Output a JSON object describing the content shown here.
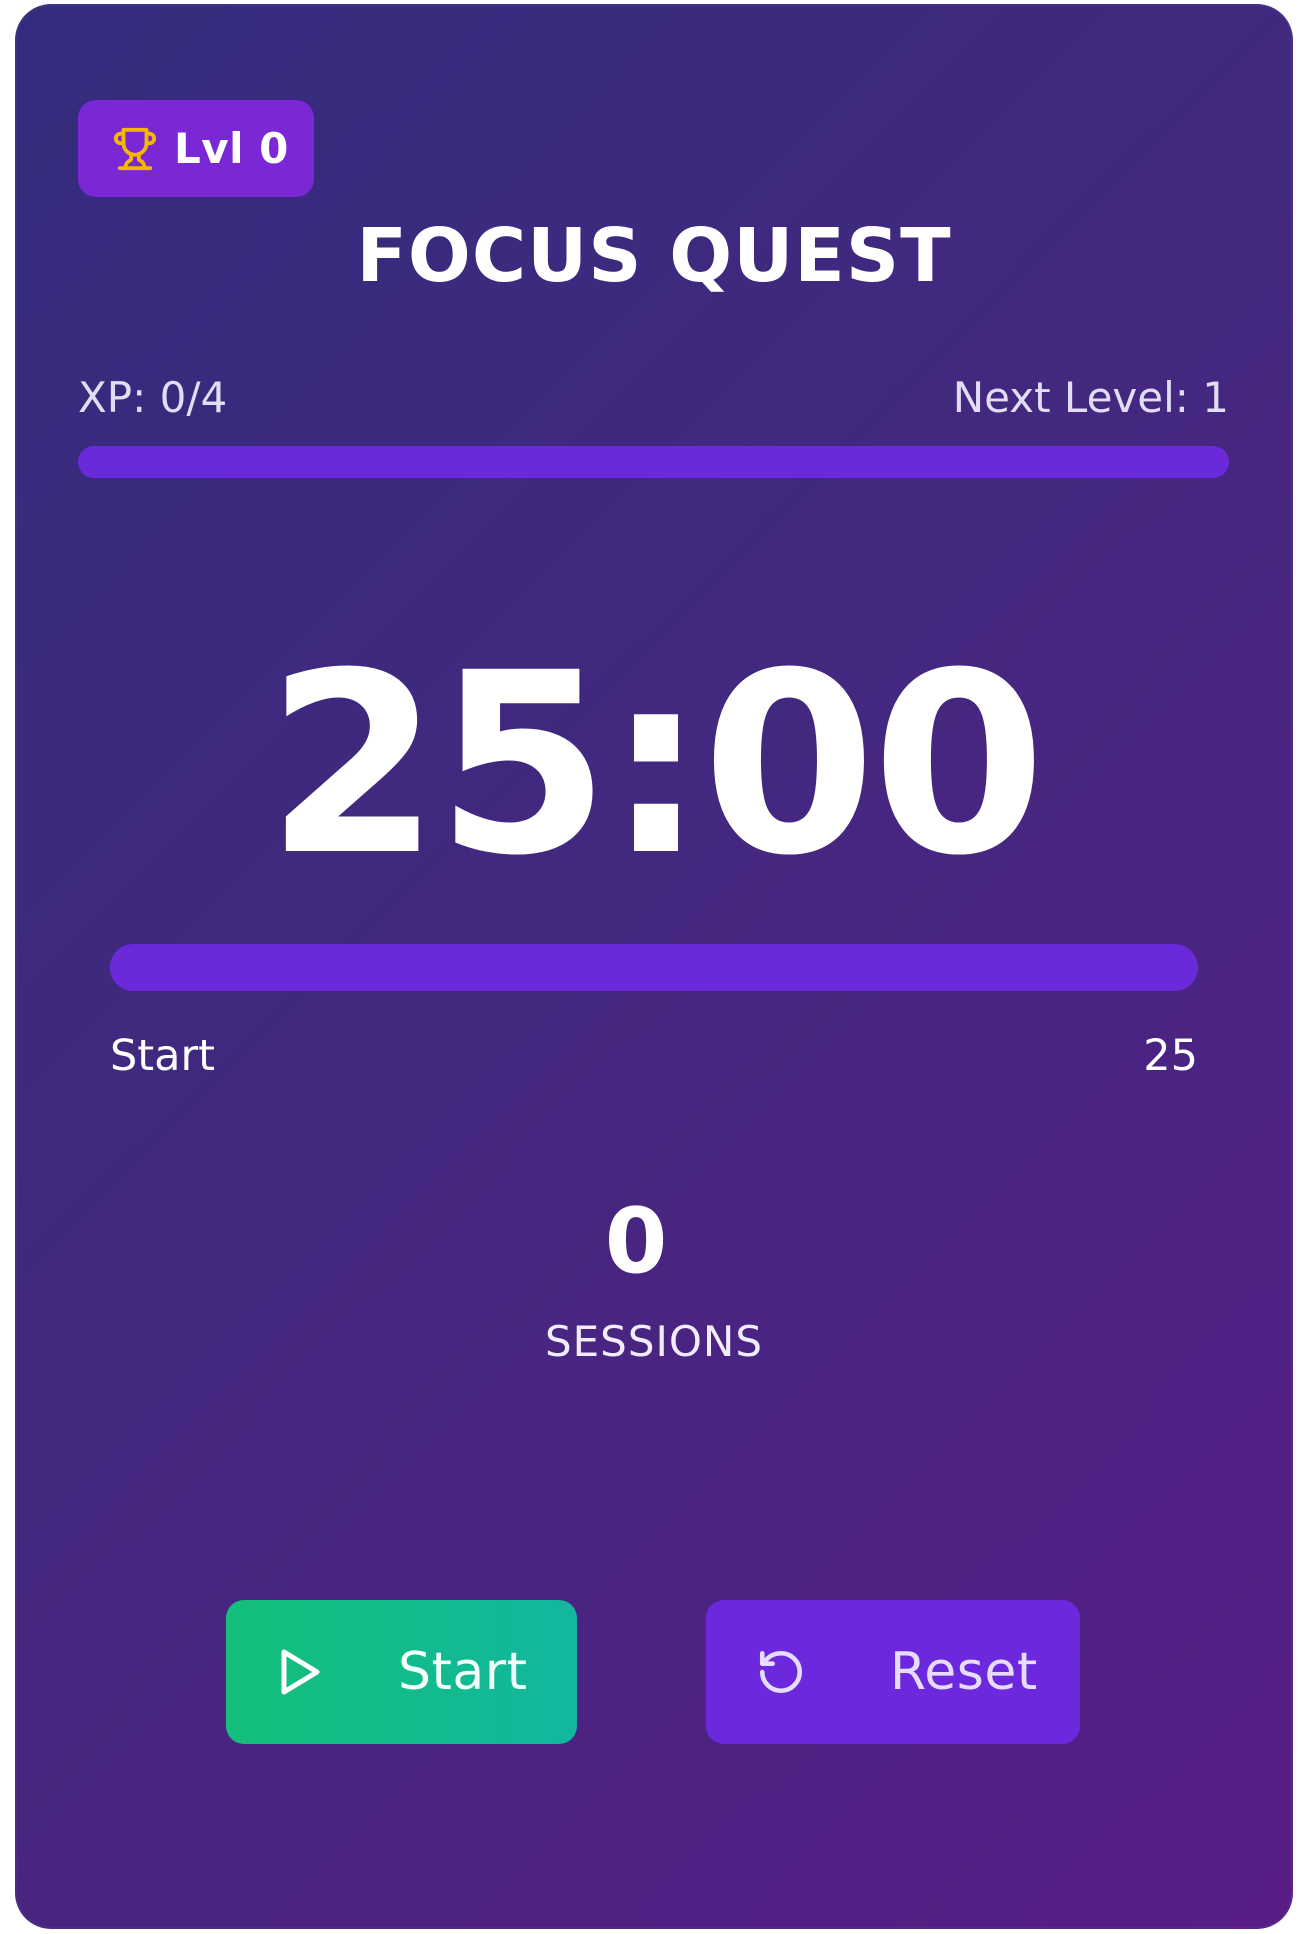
{
  "header": {
    "level_badge": "Lvl 0",
    "title": "FOCUS QUEST"
  },
  "xp": {
    "label": "XP: 0/4",
    "next_level": "Next Level: 1",
    "progress": 0
  },
  "timer": {
    "display": "25:00",
    "progress": 0,
    "range_start": "Start",
    "range_end": "25"
  },
  "stats": {
    "sessions_count": "0",
    "sessions_label": "SESSIONS"
  },
  "controls": {
    "start_label": "Start",
    "reset_label": "Reset"
  },
  "icons": {
    "level": "trophy-icon",
    "start": "play-icon",
    "reset": "rotate-ccw-icon"
  },
  "colors": {
    "accent": "#6b2ad9",
    "badge": "#7a27d6",
    "start_button": "#13bf79",
    "trophy": "#f5b800"
  }
}
